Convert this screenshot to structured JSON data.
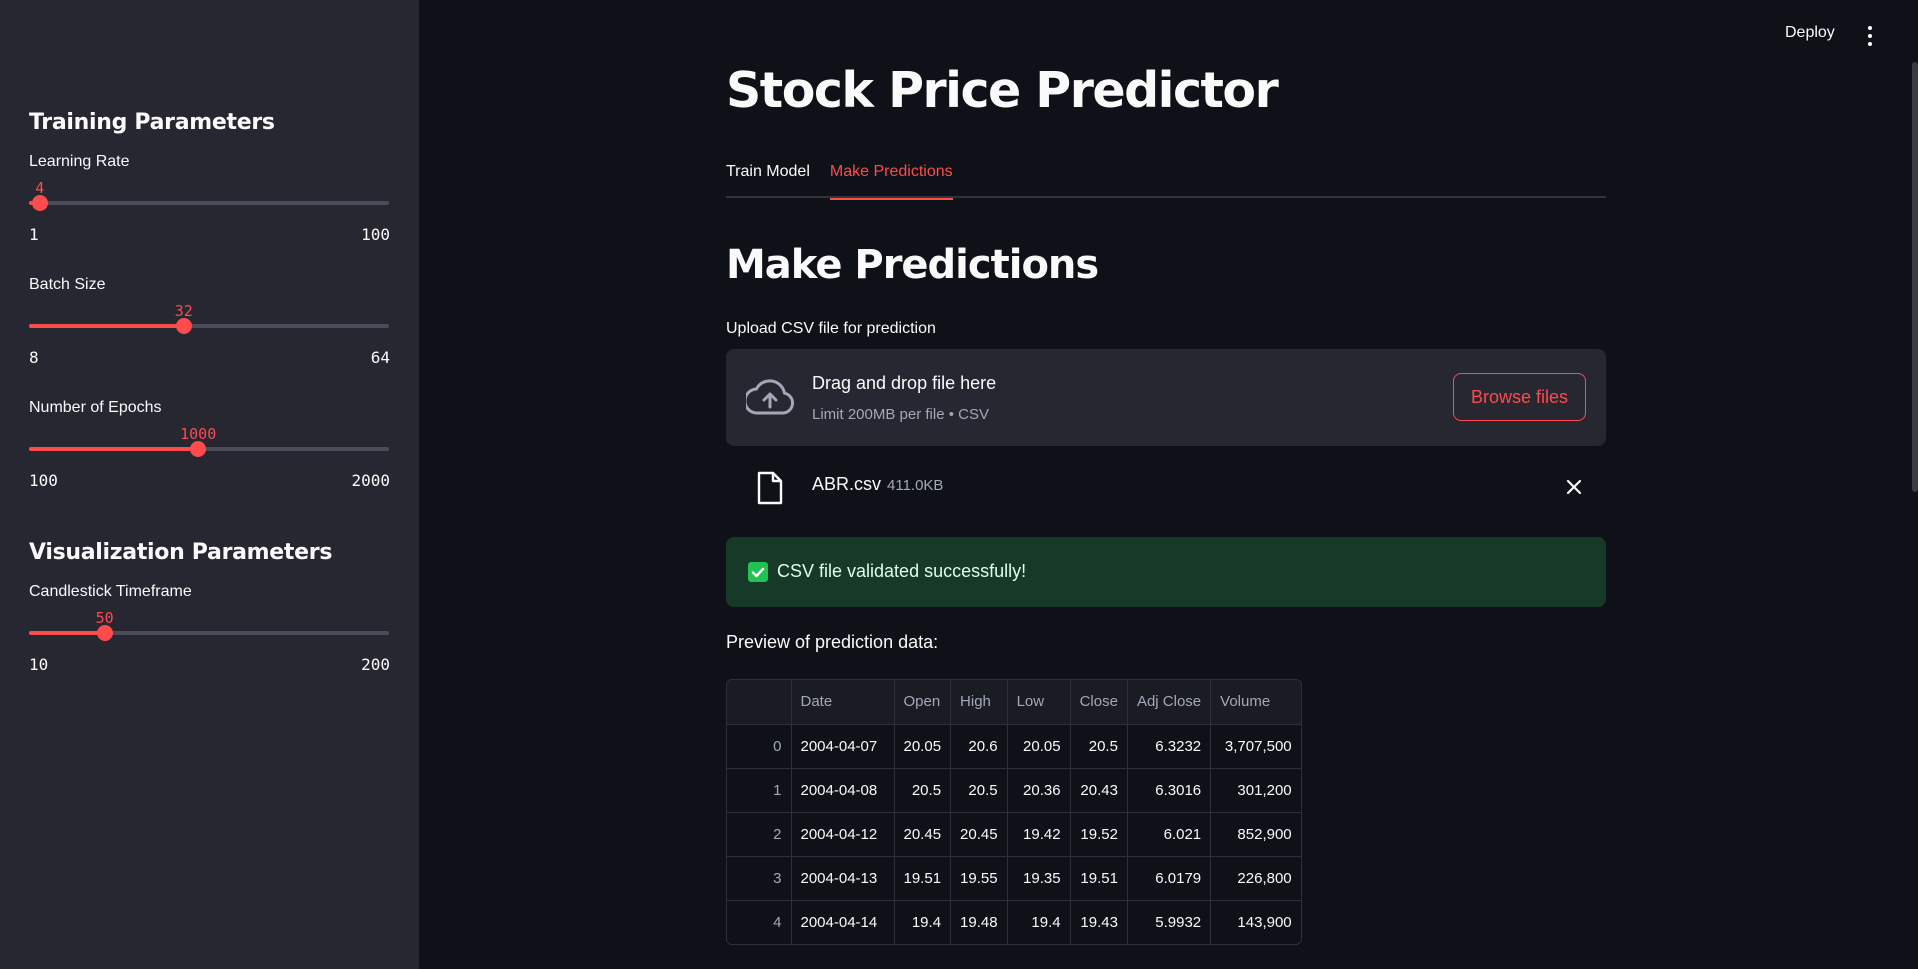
{
  "sidebar": {
    "training_heading": "Training Parameters",
    "visualization_heading": "Visualization Parameters",
    "sliders": [
      {
        "label": "Learning Rate",
        "value": "4",
        "min": "1",
        "max": "100",
        "fraction": 0.03
      },
      {
        "label": "Batch Size",
        "value": "32",
        "min": "8",
        "max": "64",
        "fraction": 0.43
      },
      {
        "label": "Number of Epochs",
        "value": "1000",
        "min": "100",
        "max": "2000",
        "fraction": 0.47
      },
      {
        "label": "Candlestick Timeframe",
        "value": "50",
        "min": "10",
        "max": "200",
        "fraction": 0.21
      }
    ]
  },
  "topbar": {
    "deploy_label": "Deploy",
    "menu_icon": "more-vert-icon"
  },
  "main": {
    "title": "Stock Price Predictor",
    "tabs": [
      {
        "label": "Train Model",
        "active": false
      },
      {
        "label": "Make Predictions",
        "active": true
      }
    ],
    "section_title": "Make Predictions",
    "uploader": {
      "label": "Upload CSV file for prediction",
      "drop_title": "Drag and drop file here",
      "drop_sub": "Limit 200MB per file • CSV",
      "browse_label": "Browse files",
      "icon": "cloud-upload-icon"
    },
    "file": {
      "name": "ABR.csv",
      "size": "411.0KB"
    },
    "success_message": "CSV file validated successfully!",
    "preview_label": "Preview of prediction data:",
    "table": {
      "columns": [
        "",
        "Date",
        "Open",
        "High",
        "Low",
        "Close",
        "Adj Close",
        "Volume"
      ],
      "rows": [
        [
          "0",
          "2004-04-07",
          "20.05",
          "20.6",
          "20.05",
          "20.5",
          "6.3232",
          "3,707,500"
        ],
        [
          "1",
          "2004-04-08",
          "20.5",
          "20.5",
          "20.36",
          "20.43",
          "6.3016",
          "301,200"
        ],
        [
          "2",
          "2004-04-12",
          "20.45",
          "20.45",
          "19.42",
          "19.52",
          "6.021",
          "852,900"
        ],
        [
          "3",
          "2004-04-13",
          "19.51",
          "19.55",
          "19.35",
          "19.51",
          "6.0179",
          "226,800"
        ],
        [
          "4",
          "2004-04-14",
          "19.4",
          "19.48",
          "19.4",
          "19.43",
          "5.9932",
          "143,900"
        ]
      ]
    }
  },
  "colors": {
    "accent": "#ff4b4b",
    "background": "#0e1117",
    "sidebar": "#262730",
    "success_bg": "#173928",
    "success_check": "#21c354"
  }
}
